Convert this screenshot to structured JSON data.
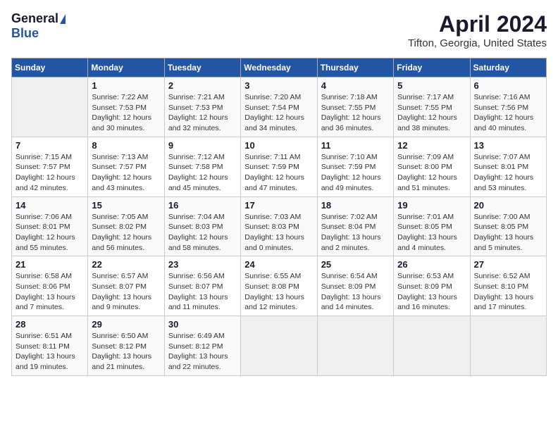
{
  "logo": {
    "general": "General",
    "blue": "Blue"
  },
  "title": {
    "month": "April 2024",
    "location": "Tifton, Georgia, United States"
  },
  "days_of_week": [
    "Sunday",
    "Monday",
    "Tuesday",
    "Wednesday",
    "Thursday",
    "Friday",
    "Saturday"
  ],
  "weeks": [
    [
      {
        "day": "",
        "detail": ""
      },
      {
        "day": "1",
        "detail": "Sunrise: 7:22 AM\nSunset: 7:53 PM\nDaylight: 12 hours\nand 30 minutes."
      },
      {
        "day": "2",
        "detail": "Sunrise: 7:21 AM\nSunset: 7:53 PM\nDaylight: 12 hours\nand 32 minutes."
      },
      {
        "day": "3",
        "detail": "Sunrise: 7:20 AM\nSunset: 7:54 PM\nDaylight: 12 hours\nand 34 minutes."
      },
      {
        "day": "4",
        "detail": "Sunrise: 7:18 AM\nSunset: 7:55 PM\nDaylight: 12 hours\nand 36 minutes."
      },
      {
        "day": "5",
        "detail": "Sunrise: 7:17 AM\nSunset: 7:55 PM\nDaylight: 12 hours\nand 38 minutes."
      },
      {
        "day": "6",
        "detail": "Sunrise: 7:16 AM\nSunset: 7:56 PM\nDaylight: 12 hours\nand 40 minutes."
      }
    ],
    [
      {
        "day": "7",
        "detail": "Sunrise: 7:15 AM\nSunset: 7:57 PM\nDaylight: 12 hours\nand 42 minutes."
      },
      {
        "day": "8",
        "detail": "Sunrise: 7:13 AM\nSunset: 7:57 PM\nDaylight: 12 hours\nand 43 minutes."
      },
      {
        "day": "9",
        "detail": "Sunrise: 7:12 AM\nSunset: 7:58 PM\nDaylight: 12 hours\nand 45 minutes."
      },
      {
        "day": "10",
        "detail": "Sunrise: 7:11 AM\nSunset: 7:59 PM\nDaylight: 12 hours\nand 47 minutes."
      },
      {
        "day": "11",
        "detail": "Sunrise: 7:10 AM\nSunset: 7:59 PM\nDaylight: 12 hours\nand 49 minutes."
      },
      {
        "day": "12",
        "detail": "Sunrise: 7:09 AM\nSunset: 8:00 PM\nDaylight: 12 hours\nand 51 minutes."
      },
      {
        "day": "13",
        "detail": "Sunrise: 7:07 AM\nSunset: 8:01 PM\nDaylight: 12 hours\nand 53 minutes."
      }
    ],
    [
      {
        "day": "14",
        "detail": "Sunrise: 7:06 AM\nSunset: 8:01 PM\nDaylight: 12 hours\nand 55 minutes."
      },
      {
        "day": "15",
        "detail": "Sunrise: 7:05 AM\nSunset: 8:02 PM\nDaylight: 12 hours\nand 56 minutes."
      },
      {
        "day": "16",
        "detail": "Sunrise: 7:04 AM\nSunset: 8:03 PM\nDaylight: 12 hours\nand 58 minutes."
      },
      {
        "day": "17",
        "detail": "Sunrise: 7:03 AM\nSunset: 8:03 PM\nDaylight: 13 hours\nand 0 minutes."
      },
      {
        "day": "18",
        "detail": "Sunrise: 7:02 AM\nSunset: 8:04 PM\nDaylight: 13 hours\nand 2 minutes."
      },
      {
        "day": "19",
        "detail": "Sunrise: 7:01 AM\nSunset: 8:05 PM\nDaylight: 13 hours\nand 4 minutes."
      },
      {
        "day": "20",
        "detail": "Sunrise: 7:00 AM\nSunset: 8:05 PM\nDaylight: 13 hours\nand 5 minutes."
      }
    ],
    [
      {
        "day": "21",
        "detail": "Sunrise: 6:58 AM\nSunset: 8:06 PM\nDaylight: 13 hours\nand 7 minutes."
      },
      {
        "day": "22",
        "detail": "Sunrise: 6:57 AM\nSunset: 8:07 PM\nDaylight: 13 hours\nand 9 minutes."
      },
      {
        "day": "23",
        "detail": "Sunrise: 6:56 AM\nSunset: 8:07 PM\nDaylight: 13 hours\nand 11 minutes."
      },
      {
        "day": "24",
        "detail": "Sunrise: 6:55 AM\nSunset: 8:08 PM\nDaylight: 13 hours\nand 12 minutes."
      },
      {
        "day": "25",
        "detail": "Sunrise: 6:54 AM\nSunset: 8:09 PM\nDaylight: 13 hours\nand 14 minutes."
      },
      {
        "day": "26",
        "detail": "Sunrise: 6:53 AM\nSunset: 8:09 PM\nDaylight: 13 hours\nand 16 minutes."
      },
      {
        "day": "27",
        "detail": "Sunrise: 6:52 AM\nSunset: 8:10 PM\nDaylight: 13 hours\nand 17 minutes."
      }
    ],
    [
      {
        "day": "28",
        "detail": "Sunrise: 6:51 AM\nSunset: 8:11 PM\nDaylight: 13 hours\nand 19 minutes."
      },
      {
        "day": "29",
        "detail": "Sunrise: 6:50 AM\nSunset: 8:12 PM\nDaylight: 13 hours\nand 21 minutes."
      },
      {
        "day": "30",
        "detail": "Sunrise: 6:49 AM\nSunset: 8:12 PM\nDaylight: 13 hours\nand 22 minutes."
      },
      {
        "day": "",
        "detail": ""
      },
      {
        "day": "",
        "detail": ""
      },
      {
        "day": "",
        "detail": ""
      },
      {
        "day": "",
        "detail": ""
      }
    ]
  ]
}
